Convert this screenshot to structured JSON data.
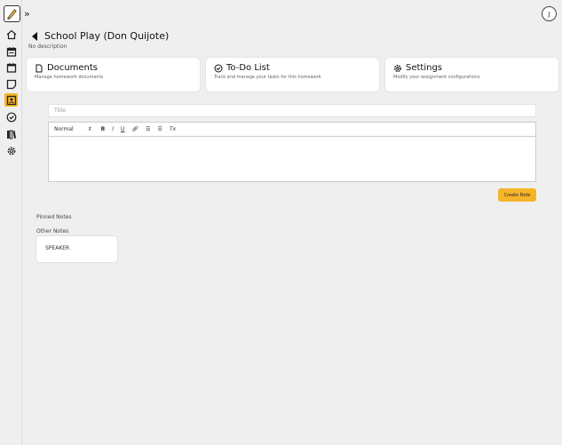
{
  "header": {
    "expand_icon": "double-chevron-right-icon",
    "avatar_initial": "J"
  },
  "sidebar": {
    "items": [
      {
        "name": "home",
        "icon": "home-icon"
      },
      {
        "name": "calendar",
        "icon": "calendar-icon"
      },
      {
        "name": "calendar-alt",
        "icon": "calendar-blank-icon"
      },
      {
        "name": "notes",
        "icon": "sticky-note-icon"
      },
      {
        "name": "assignments",
        "icon": "assignment-icon",
        "active": true
      },
      {
        "name": "tasks",
        "icon": "check-circle-icon"
      },
      {
        "name": "library",
        "icon": "books-icon"
      },
      {
        "name": "settings",
        "icon": "gear-icon"
      }
    ]
  },
  "page": {
    "title": "School Play (Don Quijote)",
    "description": "No description"
  },
  "cards": [
    {
      "title": "Documents",
      "subtitle": "Manage homework documents",
      "icon": "document-icon"
    },
    {
      "title": "To-Do List",
      "subtitle": "Track and manage your tasks for this homework",
      "icon": "check-circle-icon"
    },
    {
      "title": "Settings",
      "subtitle": "Modify your assignment configurations",
      "icon": "gear-icon"
    }
  ],
  "note_form": {
    "title_placeholder": "Title",
    "format_select": "Normal",
    "toolbar": {
      "bold": "B",
      "italic": "I",
      "underline": "U",
      "clear": "Tx"
    },
    "create_label": "Create Note"
  },
  "notes": {
    "pinned_label": "Pinned Notes",
    "other_label": "Other Notes",
    "other_items": [
      {
        "title": "SPEAKER"
      }
    ]
  },
  "colors": {
    "accent": "#f6b529",
    "background": "#efefef"
  }
}
